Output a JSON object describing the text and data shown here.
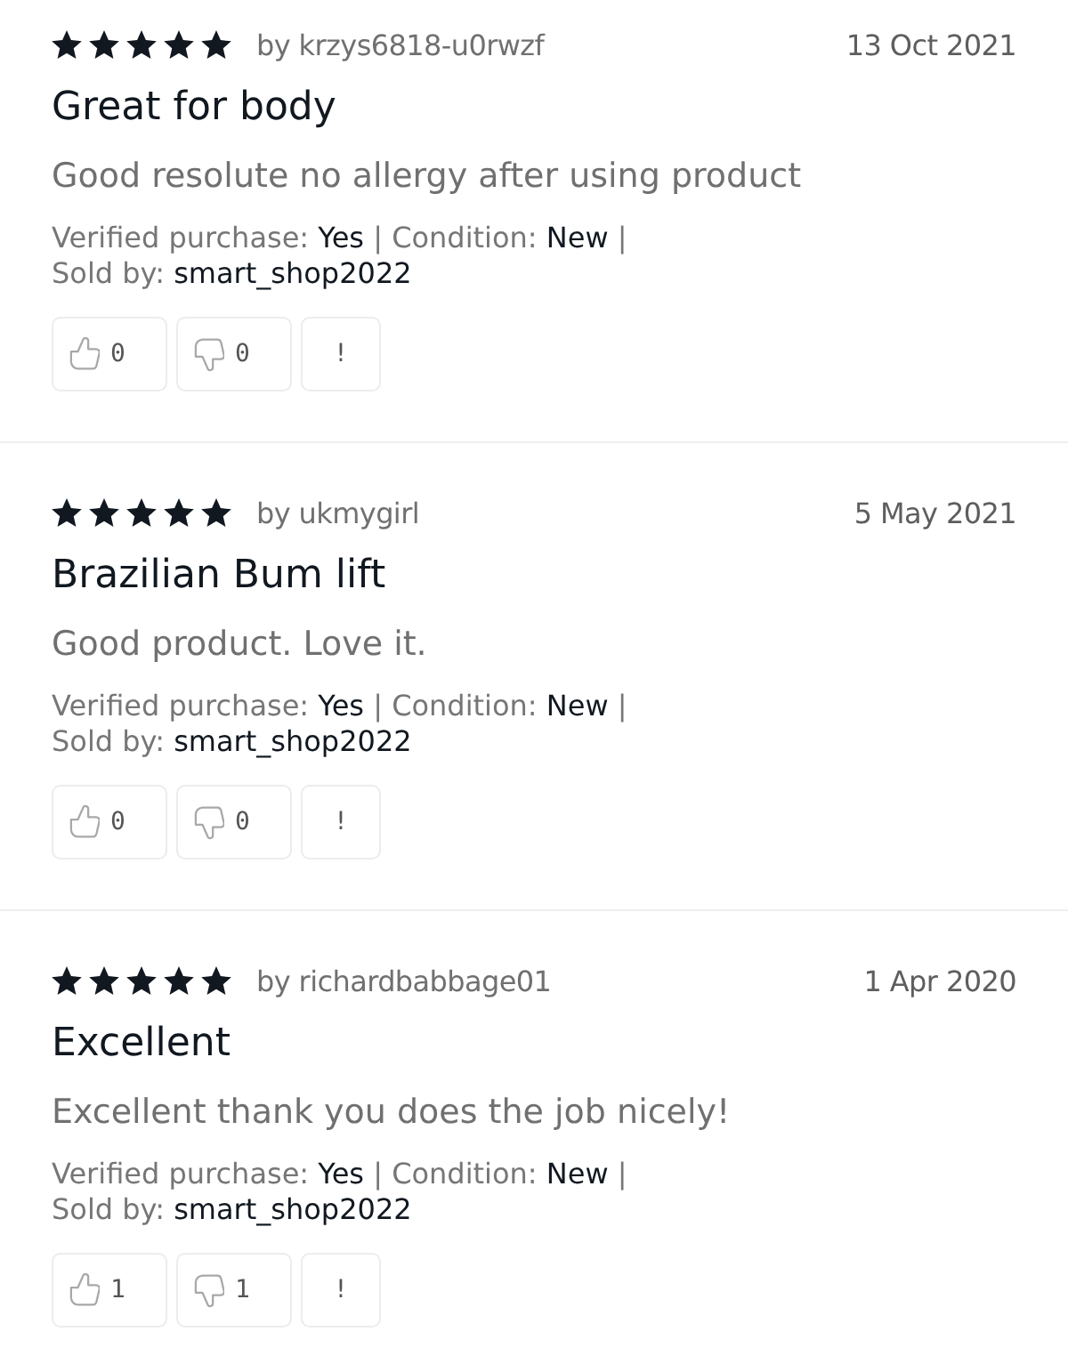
{
  "reviews": [
    {
      "stars": 5,
      "author": "by krzys6818-u0rwzf",
      "date": "13 Oct 2021",
      "title": "Great for body",
      "body": "Good resolute no allergy after using product",
      "detail_lines": [
        {
          "items": [
            {
              "label": "Verified purchase:",
              "value": "Yes",
              "separator": "|"
            },
            {
              "label": "Condition:",
              "value": "New",
              "separator": "|"
            }
          ]
        },
        {
          "items": [
            {
              "label": "Sold by:",
              "value": "smart_shop2022"
            }
          ]
        }
      ],
      "helpful_count": "0",
      "unhelpful_count": "0",
      "report": "!"
    },
    {
      "stars": 5,
      "author": "by ukmygirl",
      "date": "5 May 2021",
      "title": "Brazilian Bum lift",
      "body": "Good product. Love it.",
      "detail_lines": [
        {
          "items": [
            {
              "label": "Verified purchase:",
              "value": "Yes",
              "separator": "|"
            },
            {
              "label": "Condition:",
              "value": "New",
              "separator": "|"
            }
          ]
        },
        {
          "items": [
            {
              "label": "Sold by:",
              "value": "smart_shop2022"
            }
          ]
        }
      ],
      "helpful_count": "0",
      "unhelpful_count": "0",
      "report": "!"
    },
    {
      "stars": 5,
      "author": "by richardbabbage01",
      "date": "1 Apr 2020",
      "title": "Excellent",
      "body": "Excellent thank you does the job nicely!",
      "detail_lines": [
        {
          "items": [
            {
              "label": "Verified purchase:",
              "value": "Yes",
              "separator": "|"
            },
            {
              "label": "Condition:",
              "value": "New",
              "separator": "|"
            }
          ]
        },
        {
          "items": [
            {
              "label": "Sold by:",
              "value": "smart_shop2022"
            }
          ]
        }
      ],
      "helpful_count": "1",
      "unhelpful_count": "1",
      "report": "!"
    }
  ]
}
